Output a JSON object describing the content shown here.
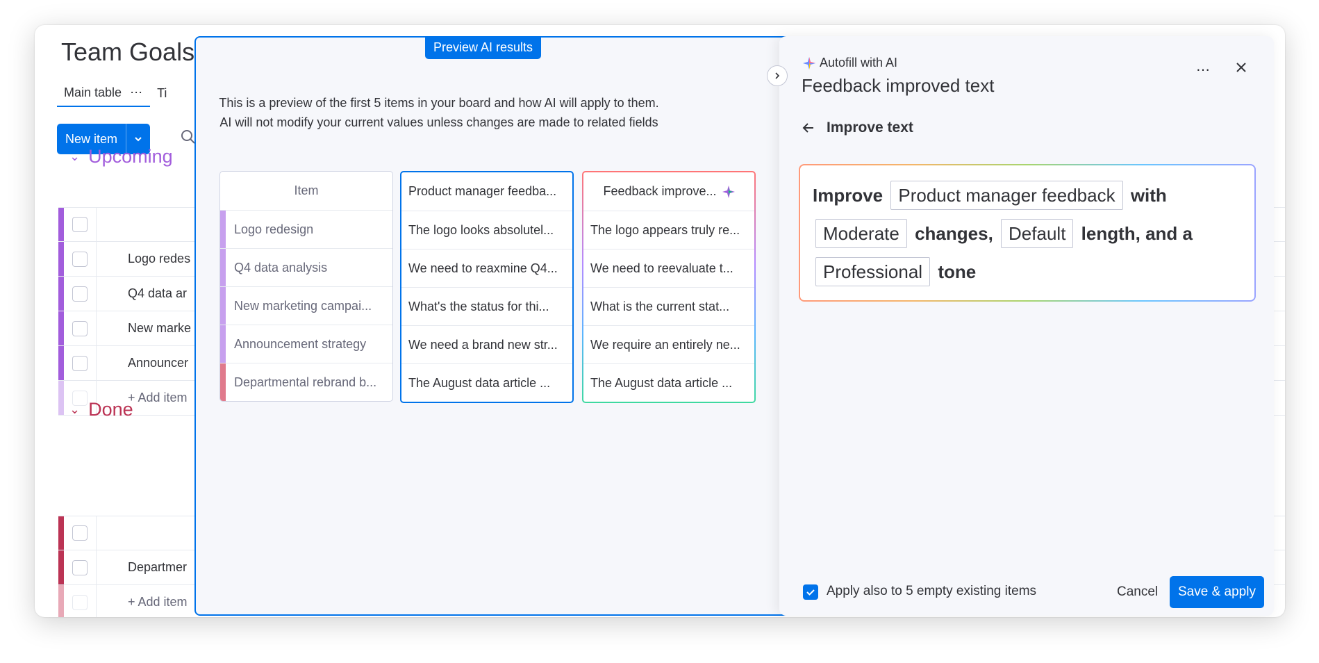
{
  "board": {
    "title": "Team Goals",
    "tabs": [
      {
        "label": "Main table"
      },
      {
        "label": "Ti"
      }
    ],
    "new_item_label": "New item",
    "groups": [
      {
        "title": "Upcoming",
        "color": "#a25ddc",
        "items": [
          "Logo redes",
          "Q4 data ar",
          "New marke",
          "Announcer"
        ],
        "add_label": "+ Add item"
      },
      {
        "title": "Done",
        "color": "#bb3354",
        "items": [
          "Departmer"
        ],
        "add_label": "+ Add item"
      }
    ]
  },
  "preview": {
    "badge": "Preview AI results",
    "desc_line1": "This is a preview of the first 5 items in your board and how AI will apply to them.",
    "desc_line2": "AI will not modify your current values unless changes are made to related fields",
    "item_column": {
      "header": "Item",
      "cells": [
        {
          "text": "Logo redesign",
          "color": "#c7a0ee"
        },
        {
          "text": "Q4 data analysis",
          "color": "#c7a0ee"
        },
        {
          "text": "New marketing campai...",
          "color": "#c7a0ee"
        },
        {
          "text": "Announcement strategy",
          "color": "#c7a0ee"
        },
        {
          "text": "Departmental rebrand b...",
          "color": "#e07a8c"
        }
      ]
    },
    "source_column": {
      "header": "Product manager feedba...",
      "cells": [
        "The logo looks absolutel...",
        "We need to reaxmine Q4...",
        "What's the status for thi...",
        "We need a brand new str...",
        "The August data article ..."
      ]
    },
    "result_column": {
      "header": "Feedback improve...",
      "cells": [
        "The logo appears truly re...",
        "We need to reevaluate t...",
        "What is the current stat...",
        "We require an entirely ne...",
        "The August data article ..."
      ]
    }
  },
  "panel": {
    "subtitle": "Autofill with AI",
    "title": "Feedback improved text",
    "back_label": "Improve text",
    "prompt": {
      "w1": "Improve",
      "chip1": "Product manager feedback",
      "w2": "with",
      "chip2": "Moderate",
      "w3": "changes,",
      "chip3": "Default",
      "w4": "length, and a",
      "chip4": "Professional",
      "w5": "tone"
    },
    "apply_label": "Apply also to 5 empty existing items",
    "cancel_label": "Cancel",
    "save_label": "Save & apply"
  }
}
